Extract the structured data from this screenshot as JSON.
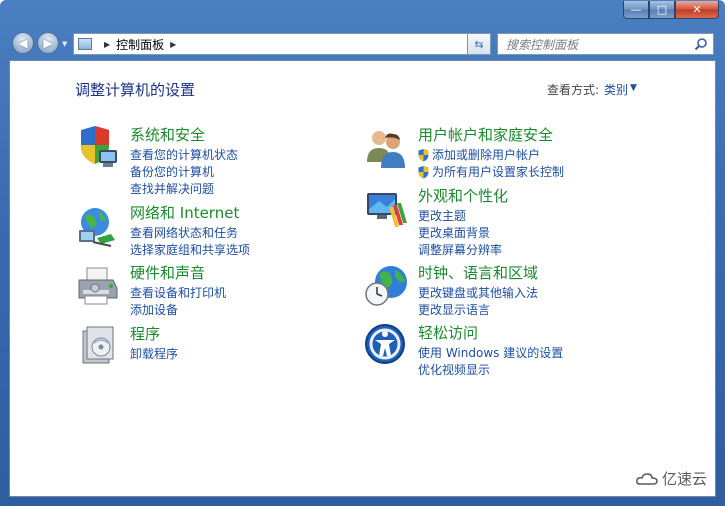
{
  "window": {
    "minimize": "—",
    "maximize": "□",
    "close": "✕"
  },
  "nav": {
    "breadcrumb": "控制面板",
    "search_placeholder": "搜索控制面板"
  },
  "page": {
    "title": "调整计算机的设置",
    "view_by_label": "查看方式:",
    "view_by_value": "类别"
  },
  "categories": [
    {
      "title": "系统和安全",
      "icon": "shield-computer-icon",
      "links": [
        "查看您的计算机状态",
        "备份您的计算机",
        "查找并解决问题"
      ]
    },
    {
      "title": "网络和 Internet",
      "icon": "network-globe-icon",
      "links": [
        "查看网络状态和任务",
        "选择家庭组和共享选项"
      ]
    },
    {
      "title": "硬件和声音",
      "icon": "printer-icon",
      "links": [
        "查看设备和打印机",
        "添加设备"
      ]
    },
    {
      "title": "程序",
      "icon": "programs-icon",
      "links": [
        "卸载程序"
      ]
    },
    {
      "title": "用户帐户和家庭安全",
      "icon": "users-icon",
      "links": [
        "添加或删除用户帐户",
        "为所有用户设置家长控制"
      ]
    },
    {
      "title": "外观和个性化",
      "icon": "display-paint-icon",
      "links": [
        "更改主题",
        "更改桌面背景",
        "调整屏幕分辨率"
      ]
    },
    {
      "title": "时钟、语言和区域",
      "icon": "clock-globe-icon",
      "links": [
        "更改键盘或其他输入法",
        "更改显示语言"
      ]
    },
    {
      "title": "轻松访问",
      "icon": "ease-of-access-icon",
      "links": [
        "使用 Windows 建议的设置",
        "优化视频显示"
      ]
    }
  ],
  "watermark": "亿速云"
}
